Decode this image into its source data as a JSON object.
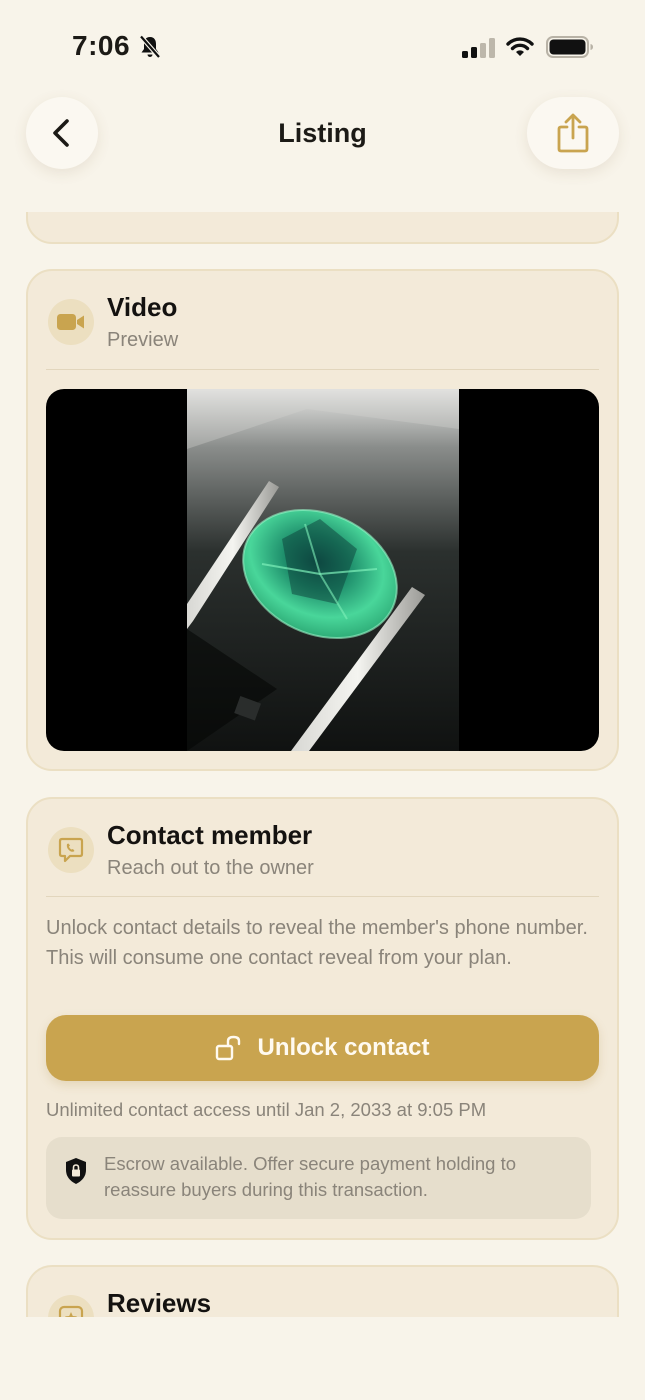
{
  "status_bar": {
    "time": "7:06",
    "icons": [
      "bell-slash-icon",
      "signal-icon",
      "wifi-icon",
      "battery-icon"
    ]
  },
  "nav": {
    "title": "Listing",
    "back_icon": "chevron-left-icon",
    "share_icon": "share-icon"
  },
  "video_card": {
    "icon": "video-camera-icon",
    "title": "Video",
    "subtitle": "Preview"
  },
  "contact_card": {
    "icon": "chat-bubble-icon",
    "title": "Contact member",
    "subtitle": "Reach out to the owner",
    "description": "Unlock contact details to reveal the member's phone number. This will consume one contact reveal from your plan.",
    "unlock_label": "Unlock contact",
    "unlock_icon": "unlock-icon",
    "access_note": "Unlimited contact access until Jan 2, 2033 at 9:05 PM",
    "escrow_icon": "shield-lock-icon",
    "escrow_text": "Escrow available. Offer secure payment holding to reassure buyers during this transaction."
  },
  "reviews_card": {
    "icon": "star-icon",
    "title": "Reviews"
  },
  "colors": {
    "background": "#f8f4ea",
    "card": "#f3ead9",
    "accent": "#c9a44f",
    "muted_text": "#8a847a"
  }
}
